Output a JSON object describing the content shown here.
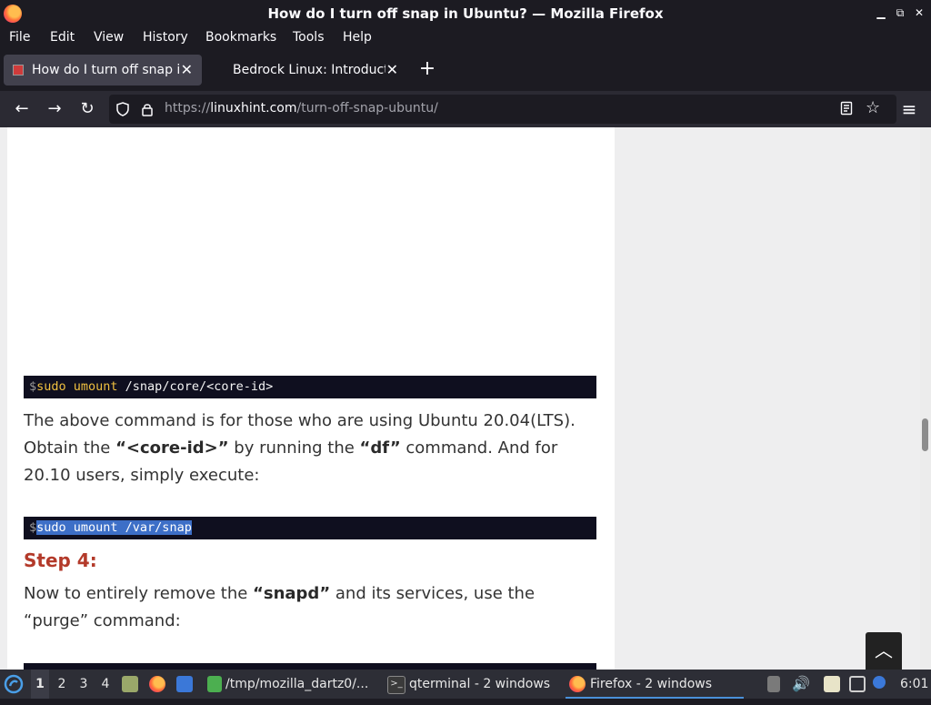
{
  "window": {
    "title": "How do I turn off snap in Ubuntu? — Mozilla Firefox"
  },
  "menu": [
    "File",
    "Edit",
    "View",
    "History",
    "Bookmarks",
    "Tools",
    "Help"
  ],
  "tabs": [
    {
      "label": "How do I turn off snap in Ubuntu?",
      "active": true
    },
    {
      "label": "Bedrock Linux: Introduction",
      "active": false
    }
  ],
  "url": {
    "host": "linuxhint.com",
    "scheme": "https://",
    "path": "/turn-off-snap-ubuntu/"
  },
  "article": {
    "code1": {
      "prompt": "$",
      "cmd": "sudo umount",
      "rest": " /snap/core/<core-id>"
    },
    "para1": {
      "line1": "The above command is for those who are using Ubuntu 20.04(LTS).",
      "line2_pre": "Obtain the ",
      "line2_bold1": "“<core-id>”",
      "line2_mid": " by running the ",
      "line2_bold2": "“df”",
      "line2_post": " command. And for",
      "line3": "20.10 users, simply execute:"
    },
    "code2": {
      "prompt": "$",
      "selected": "sudo umount /var/snap"
    },
    "step_heading": "Step 4:",
    "para2": {
      "line1_pre": "Now to entirely remove the ",
      "line1_bold": "“snapd”",
      "line1_post": " and its services, use the",
      "line2": "“purge” command:"
    }
  },
  "taskbar": {
    "workspaces": [
      "1",
      "2",
      "3",
      "4"
    ],
    "windows": [
      {
        "label": "/tmp/mozilla_dartz0/...",
        "icon": "file-icon"
      },
      {
        "label": "qterminal - 2 windows",
        "icon": "terminal-icon"
      },
      {
        "label": "Firefox - 2 windows",
        "icon": "firefox-icon",
        "active": true
      }
    ],
    "clock": "6:01"
  },
  "colors": {
    "accent": "#b33a2a",
    "selection": "#3d6fc7",
    "code_bg": "#0f0f1f"
  }
}
